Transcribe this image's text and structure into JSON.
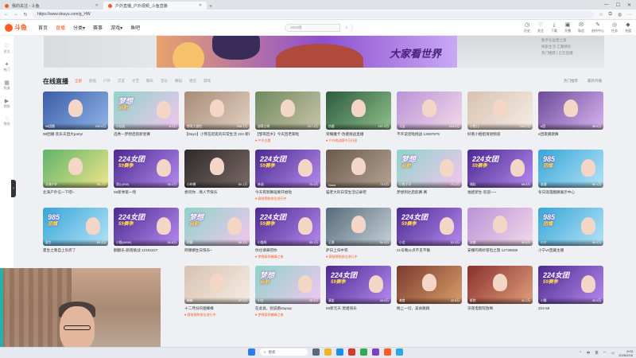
{
  "browser": {
    "tabs": [
      {
        "label": "我的关注 - 斗鱼"
      },
      {
        "label": "户外直播_户外视频_斗鱼直播"
      }
    ],
    "url": "https://www.douyu.com/g_HW",
    "new_tab_glyph": "+",
    "minimize_glyph": "—",
    "maximize_glyph": "☐",
    "close_glyph": "✕"
  },
  "site": {
    "logo_text": "斗鱼",
    "nav": [
      "首页",
      "直播",
      "分类▾",
      "赛事",
      "游戏▾",
      "鱼吧"
    ],
    "search_placeholder": "2002级",
    "header_icons": [
      {
        "label": "历史",
        "icon": "history-icon",
        "glyph": "◷"
      },
      {
        "label": "关注",
        "icon": "heart-icon",
        "glyph": "♡"
      },
      {
        "label": "下载",
        "icon": "download-icon",
        "glyph": "⤓"
      },
      {
        "label": "开播",
        "icon": "camera-icon",
        "glyph": "▣"
      },
      {
        "label": "私信",
        "icon": "message-icon",
        "glyph": "✉"
      },
      {
        "label": "创作中心",
        "icon": "creator-icon",
        "glyph": "✎"
      },
      {
        "label": "任务",
        "icon": "task-icon",
        "glyph": "◎"
      },
      {
        "label": "充值",
        "icon": "wallet-icon",
        "glyph": "◆"
      }
    ]
  },
  "sidebar": {
    "items": [
      {
        "label": "关注",
        "icon": "heart-icon",
        "glyph": "♡"
      },
      {
        "label": "热门",
        "icon": "fire-icon",
        "glyph": "✦"
      },
      {
        "label": "频道",
        "icon": "channel-icon",
        "glyph": "▦"
      },
      {
        "label": "视频",
        "icon": "video-icon",
        "glyph": "▶"
      },
      {
        "label": "鱼吧",
        "icon": "fish-icon",
        "glyph": "◌"
      }
    ],
    "collapse_glyph": "‹"
  },
  "banner": {
    "slogan": "大家看世界",
    "side_text_1": "数字化运营之旅",
    "side_text_2": "探索生活·汇聚精彩",
    "side_text_3": "热门推荐 | 正在直播"
  },
  "section": {
    "title": "在线直播",
    "filters": [
      "全部",
      "颜值",
      "户外",
      "交友",
      "才艺",
      "聊天",
      "音乐",
      "舞蹈",
      "唱见",
      "游戏"
    ],
    "active_filter": "全部",
    "right_links": [
      "热门推荐",
      "最新开播"
    ]
  },
  "cards": [
    {
      "title": "98团播·欢乐天团大party!",
      "user": "98团播",
      "viewers": "292.6万",
      "tag": "",
      "badge": "",
      "kind": "group"
    },
    {
      "title": "选秀—梦想启航新星赛",
      "user": "小仙女",
      "viewers": "8.1万",
      "tag": "",
      "badge": "",
      "kind": "dream"
    },
    {
      "title": "【Day1】小熊在逛逛的日常生活 224 新赛季",
      "user": "熊哥大冒险",
      "viewers": "248.7万",
      "tag": "",
      "badge": "",
      "kind": "man"
    },
    {
      "title": "【邹哥回乡】今天回老家啦",
      "user": "邹哥日常",
      "viewers": "227.1万",
      "tag": "户外主题",
      "badge": "",
      "kind": "outdoor"
    },
    {
      "title": "荣耀魔卡·伪鹿挑战直播",
      "user": "伪鹿",
      "viewers": "197.3万",
      "tag": "户外挑战赛今日开启",
      "badge": "",
      "kind": "outdoor2"
    },
    {
      "title": "不许说话啦挑战 12697875",
      "user": "元宝",
      "viewers": "143.3万",
      "tag": "",
      "badge": "",
      "kind": "girl"
    },
    {
      "title": "好看小姐姐请进频道",
      "user": "小鱼儿",
      "viewers": "102.7万",
      "tag": "",
      "badge": "",
      "kind": "girl2"
    },
    {
      "title": "e团夜播歌舞",
      "user": "e团",
      "viewers": "96.5万",
      "tag": "",
      "badge": "",
      "kind": "girl3"
    },
    {
      "title": "北海户外信一下吧~",
      "user": "北海户外",
      "viewers": "95.2万",
      "tag": "",
      "badge": "",
      "kind": "diary"
    },
    {
      "title": "59新季第一场",
      "user": "酒心(KW)",
      "viewers": "90.2万",
      "tag": "",
      "badge": "",
      "kind": "t224"
    },
    {
      "title": "想问你…情人节快乐",
      "user": "小梓酱",
      "viewers": "82.1万",
      "tag": "",
      "badge": "",
      "kind": "dark"
    },
    {
      "title": "今天有新舞蹈要开始啦",
      "user": "林涵",
      "viewers": "76.4万",
      "tag": "赛前预热排位进行中",
      "badge": "",
      "kind": "t224"
    },
    {
      "title": "猫老大的日常生活记录吧",
      "user": "Nana",
      "viewers": "73.9万",
      "tag": "",
      "badge": "",
      "kind": "room"
    },
    {
      "title": "梦想到达启航赛·赛",
      "user": "小鱼小可",
      "viewers": "70.2万",
      "tag": "",
      "badge": "",
      "kind": "dream"
    },
    {
      "title": "福娃新生·欢迎一~",
      "user": "福娃",
      "viewers": "68.5万",
      "tag": "",
      "badge": "",
      "kind": "t224"
    },
    {
      "title": "冬日浪漫翻跳展示中心",
      "user": "浪漫",
      "viewers": "66.1万",
      "tag": "",
      "badge": "",
      "kind": "c985"
    },
    {
      "title": "夏生之我自上队挤了",
      "user": "夏生",
      "viewers": "63.3万",
      "tag": "",
      "badge": "",
      "kind": "c985"
    },
    {
      "title": "翻翻乐·颜值挑战 12163227",
      "user": "小猫(WMK)",
      "viewers": "60.8万",
      "tag": "",
      "badge": "",
      "kind": "t224"
    },
    {
      "title": "阿娜娜生日快乐~",
      "user": "阿娜",
      "viewers": "58.3万",
      "tag": "",
      "badge": "",
      "kind": "dream"
    },
    {
      "title": "你也请来吧你",
      "user": "小猫咪",
      "viewers": "55.1万",
      "tag": "梦想赛季巅峰之夜",
      "badge": "",
      "kind": "t224"
    },
    {
      "title": "萨日上归中宾",
      "user": "王胖",
      "viewers": "54.4万",
      "tag": "赛前预热排位进行中",
      "badge": "",
      "kind": "man2"
    },
    {
      "title": "21号晚11点不见不散",
      "user": "小北",
      "viewers": "52.3万",
      "tag": "",
      "badge": "",
      "kind": "t224"
    },
    {
      "title": "安娜的奇妙冒险之旅 12736608",
      "user": "安娜",
      "viewers": "50.6万",
      "tag": "",
      "badge": "",
      "kind": "girl"
    },
    {
      "title": "小宁vs宝藏主播",
      "user": "小宁",
      "viewers": "49.2万",
      "tag": "",
      "badge": "",
      "kind": "c985"
    },
    {
      "title": "",
      "user": "",
      "viewers": "",
      "tag": "",
      "badge": "",
      "kind": "hidden"
    },
    {
      "title": "",
      "user": "",
      "viewers": "",
      "tag": "",
      "badge": "",
      "kind": "hidden"
    },
    {
      "title": "十二月份的烟蜂蜂",
      "user": "蜂蜂",
      "viewers": "47.1万",
      "tag": "赛前预热排位进行中",
      "badge": "",
      "kind": "girl2"
    },
    {
      "title": "在此竟，别说跑stupup",
      "user": "小白",
      "viewers": "45.3万",
      "tag": "梦想赛季巅峰之夜",
      "badge": "",
      "kind": "dream"
    },
    {
      "title": "59新元天·莫姐快乐",
      "user": "莫姐",
      "viewers": "44.0万",
      "tag": "",
      "badge": "",
      "kind": "t224"
    },
    {
      "title": "晚上一切，美食跳跳",
      "user": "美食",
      "viewers": "42.8万",
      "tag": "",
      "badge": "",
      "kind": "street"
    },
    {
      "title": "深夜电影院放映",
      "user": "影院",
      "viewers": "41.1万",
      "tag": "",
      "badge": "",
      "kind": "shop"
    },
    {
      "title": "224-59",
      "user": "小舞",
      "viewers": "40.0万",
      "tag": "",
      "badge": "",
      "kind": "t224"
    }
  ],
  "overlay_text": {
    "t224_big": "224女团",
    "t224_small": "59赛季",
    "dream_big": "梦想",
    "dream_small": "启航",
    "c985_big": "985",
    "c985_small": "团播"
  },
  "taskbar": {
    "search_label": "搜索",
    "time": "9:03",
    "date": "2025/2/16",
    "lang": "中",
    "ime": "英"
  },
  "colors": {
    "brand": "#ff5d23",
    "purple": "#7b2bd6"
  }
}
